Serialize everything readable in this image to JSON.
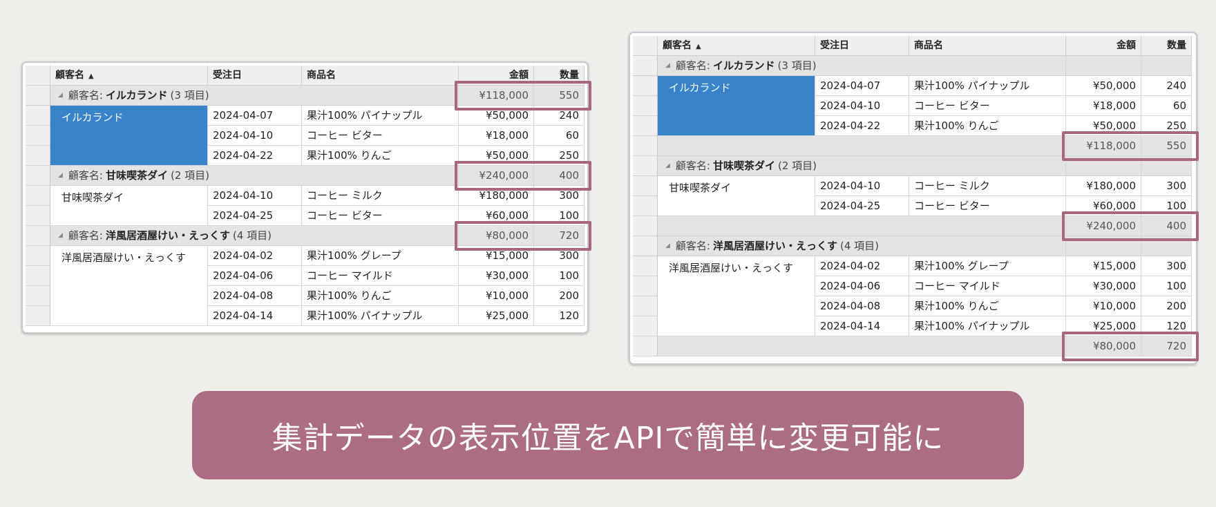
{
  "columns": {
    "customer": "顧客名",
    "date": "受注日",
    "product": "商品名",
    "amount": "金額",
    "qty": "数量"
  },
  "sort_icon": "sort-ascending-icon",
  "group_prefix": "顧客名:",
  "groups": [
    {
      "name": "イルカランド",
      "count_label": "(3 項目)",
      "total_amount": "¥118,000",
      "total_qty": "550",
      "rows": [
        {
          "date": "2024-04-07",
          "product": "果汁100% パイナップル",
          "amount": "¥50,000",
          "qty": "240"
        },
        {
          "date": "2024-04-10",
          "product": "コーヒー ビター",
          "amount": "¥18,000",
          "qty": "60"
        },
        {
          "date": "2024-04-22",
          "product": "果汁100% りんご",
          "amount": "¥50,000",
          "qty": "250"
        }
      ]
    },
    {
      "name": "甘味喫茶ダイ",
      "count_label": "(2 項目)",
      "total_amount": "¥240,000",
      "total_qty": "400",
      "rows": [
        {
          "date": "2024-04-10",
          "product": "コーヒー ミルク",
          "amount": "¥180,000",
          "qty": "300"
        },
        {
          "date": "2024-04-25",
          "product": "コーヒー ビター",
          "amount": "¥60,000",
          "qty": "100"
        }
      ]
    },
    {
      "name": "洋風居酒屋けい・えっくす",
      "count_label": "(4 項目)",
      "total_amount": "¥80,000",
      "total_qty": "720",
      "rows": [
        {
          "date": "2024-04-02",
          "product": "果汁100% グレープ",
          "amount": "¥15,000",
          "qty": "300"
        },
        {
          "date": "2024-04-06",
          "product": "コーヒー マイルド",
          "amount": "¥30,000",
          "qty": "100"
        },
        {
          "date": "2024-04-08",
          "product": "果汁100% りんご",
          "amount": "¥10,000",
          "qty": "200"
        },
        {
          "date": "2024-04-14",
          "product": "果汁100% パイナップル",
          "amount": "¥25,000",
          "qty": "120"
        }
      ]
    }
  ],
  "colors": {
    "selected": "#3883c9",
    "highlight": "#a8667f",
    "banner": "#ac6c82"
  },
  "banner_text": "集計データの表示位置をAPIで簡単に変更可能に"
}
